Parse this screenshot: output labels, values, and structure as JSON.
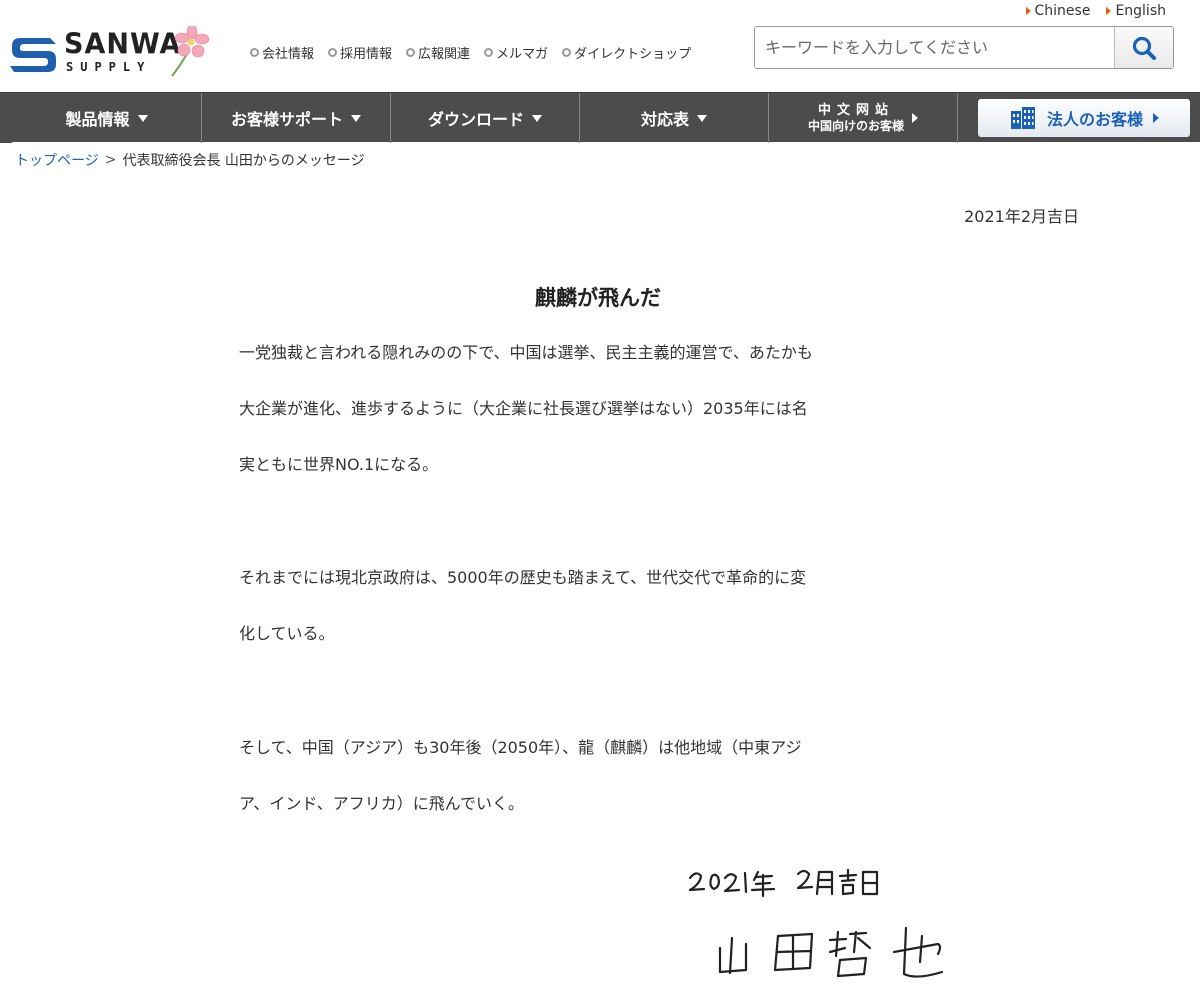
{
  "header": {
    "lang_links": [
      {
        "label": "Chinese"
      },
      {
        "label": "English"
      }
    ],
    "logo": {
      "text": "SANWA",
      "sub": "SUPPLY"
    },
    "top_links": [
      {
        "label": "会社情報"
      },
      {
        "label": "採用情報"
      },
      {
        "label": "広報関連"
      },
      {
        "label": "メルマガ"
      },
      {
        "label": "ダイレクトショップ"
      }
    ],
    "search": {
      "placeholder": "キーワードを入力してください"
    }
  },
  "nav": {
    "items": [
      {
        "label": "製品情報"
      },
      {
        "label": "お客様サポート"
      },
      {
        "label": "ダウンロード"
      },
      {
        "label": "対応表"
      }
    ],
    "chinese": {
      "top": "中文网站",
      "bottom": "中国向けのお客様"
    },
    "corporate": {
      "label": "法人のお客様"
    }
  },
  "breadcrumb": {
    "home": "トップページ",
    "separator": ">",
    "current": "代表取締役会長 山田からのメッセージ"
  },
  "article": {
    "date": "2021年2月吉日",
    "title": "麒麟が飛んだ",
    "paragraphs": [
      [
        "一党独裁と言われる隠れみのの下で、中国は選挙、民主主義的運営で、あたかも",
        "大企業が進化、進歩するように（大企業に社長選び選挙はない）2035年には名",
        "実ともに世界NO.1になる。"
      ],
      [
        "それまでには現北京政府は、5000年の歴史も踏まえて、世代交代で革命的に変",
        "化している。"
      ],
      [
        "そして、中国（アジア）も30年後（2050年）、龍（麒麟）は他地域（中東アジ",
        "ア、インド、アフリカ）に飛んでいく。"
      ]
    ],
    "signature": {
      "date": "2021年2月吉日",
      "name": "山田哲也"
    }
  },
  "colors": {
    "nav_bg": "#4c4c4c",
    "link_blue": "#1a62b8",
    "accent_orange": "#e8590c",
    "logo_blue": "#1f5fae"
  }
}
